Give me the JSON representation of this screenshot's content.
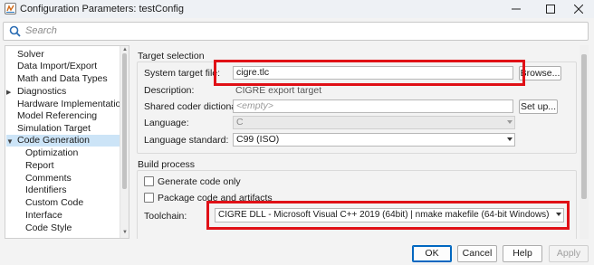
{
  "window": {
    "title": "Configuration Parameters: testConfig"
  },
  "search": {
    "placeholder": "Search"
  },
  "tree": {
    "items": [
      {
        "label": "Solver"
      },
      {
        "label": "Data Import/Export"
      },
      {
        "label": "Math and Data Types"
      },
      {
        "label": "Diagnostics"
      },
      {
        "label": "Hardware Implementation"
      },
      {
        "label": "Model Referencing"
      },
      {
        "label": "Simulation Target"
      },
      {
        "label": "Code Generation"
      },
      {
        "label": "Optimization"
      },
      {
        "label": "Report"
      },
      {
        "label": "Comments"
      },
      {
        "label": "Identifiers"
      },
      {
        "label": "Custom Code"
      },
      {
        "label": "Interface"
      },
      {
        "label": "Code Style"
      }
    ],
    "selected": "Code Generation"
  },
  "target_selection": {
    "title": "Target selection",
    "system_target_file_label": "System target file:",
    "system_target_file_value": "cigre.tlc",
    "browse_label": "Browse...",
    "description_label": "Description:",
    "description_value": "CIGRE export target",
    "shared_dict_label": "Shared coder dictionary:",
    "shared_dict_placeholder": "<empty>",
    "setup_label": "Set up...",
    "language_label": "Language:",
    "language_value": "C",
    "language_standard_label": "Language standard:",
    "language_standard_value": "C99 (ISO)"
  },
  "build_process": {
    "title": "Build process",
    "generate_code_only_label": "Generate code only",
    "package_label": "Package code and artifacts",
    "toolchain_label": "Toolchain:",
    "toolchain_value": "CIGRE DLL - Microsoft Visual C++ 2019 (64bit) | nmake makefile (64-bit Windows)"
  },
  "footer": {
    "ok": "OK",
    "cancel": "Cancel",
    "help": "Help",
    "apply": "Apply"
  },
  "colors": {
    "highlight_box": "#e01016",
    "selection": "#cce4f7",
    "accent": "#0067c0"
  }
}
